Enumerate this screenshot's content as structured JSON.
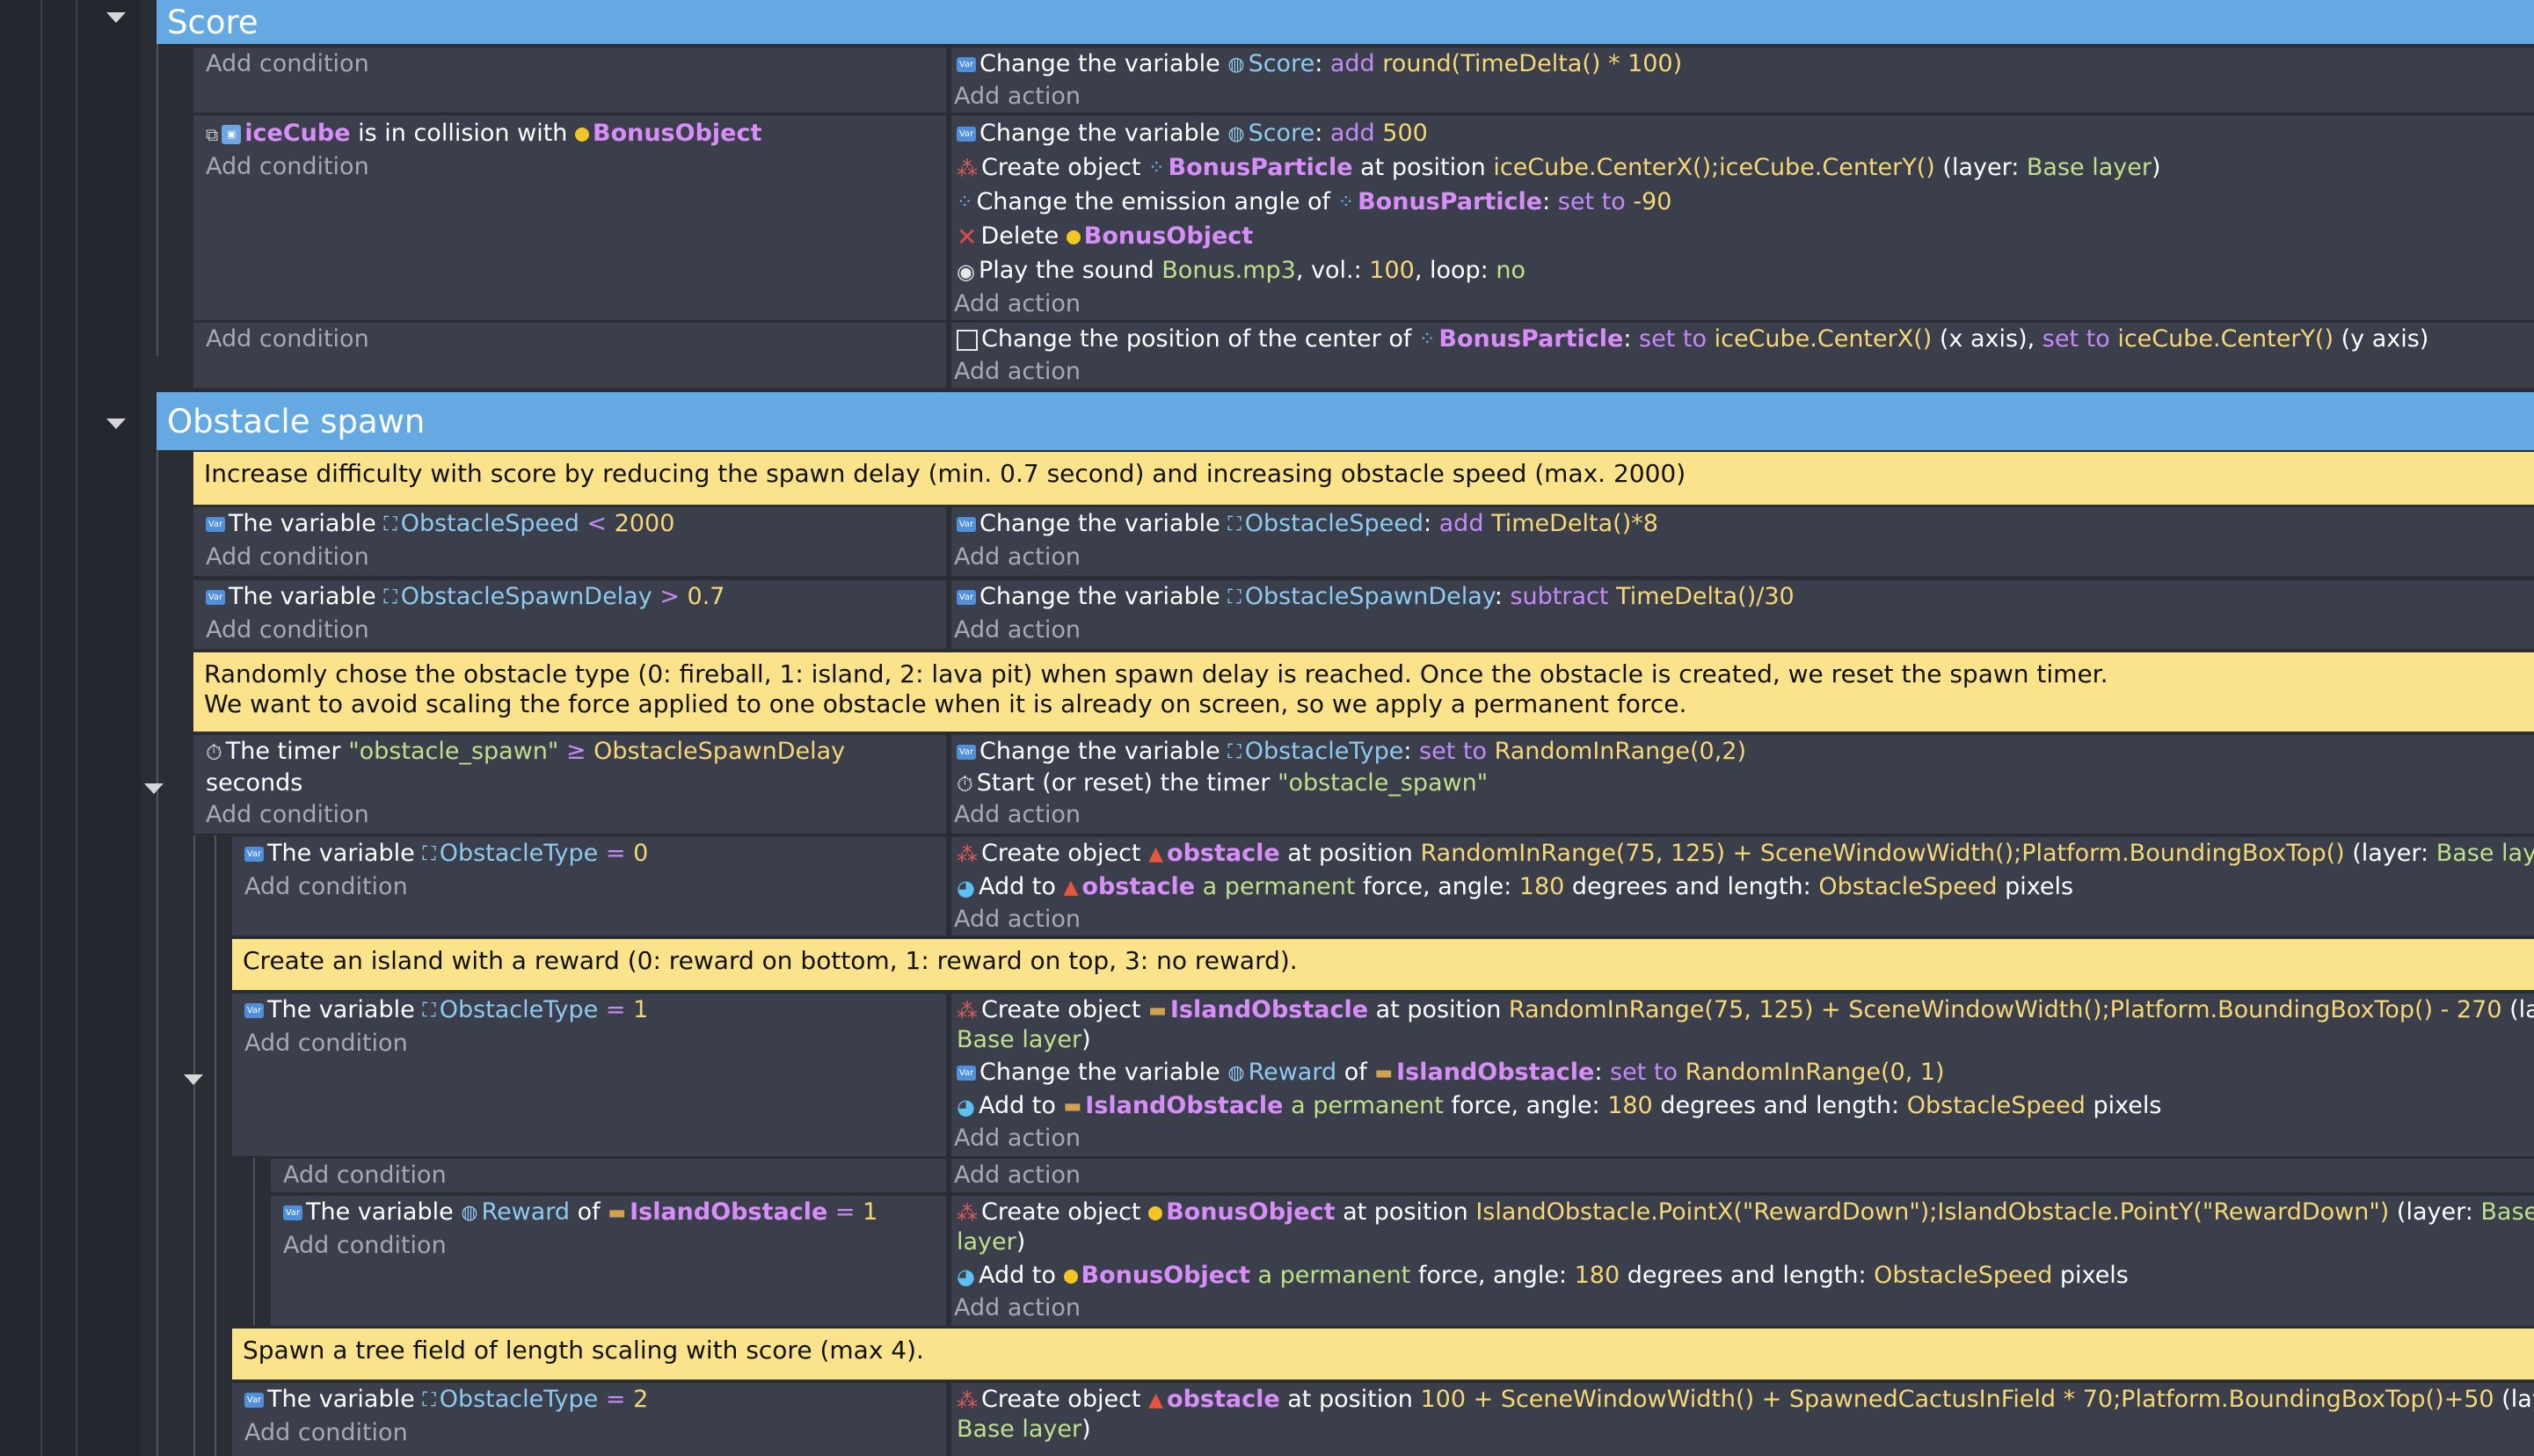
{
  "groups": {
    "score": "Score",
    "obstacle_spawn": "Obstacle spawn"
  },
  "labels": {
    "add_condition": "Add condition",
    "add_action": "Add action"
  },
  "comments": {
    "c1": "Increase difficulty with score by reducing the spawn delay (min. 0.7 second) and increasing obstacle speed (max. 2000)",
    "c2a": "Randomly chose the obstacle type (0: fireball, 1: island, 2: lava pit) when spawn delay is reached. Once the obstacle is created, we reset the spawn timer.",
    "c2b": "We want to avoid scaling the force applied to one obstacle when it is already on screen, so we apply a permanent force.",
    "c3": "Create an island with a reward (0: reward on bottom, 1: reward on top, 3: no reward).",
    "c4": "Spawn a tree field of length scaling with score (max 4)."
  },
  "events": {
    "e1": {
      "a1": [
        "Change the variable ",
        "Score",
        ": ",
        "add",
        " ",
        "round(TimeDelta() * 100)"
      ]
    },
    "e2": {
      "c1": [
        "iceCube",
        " is in collision with ",
        "BonusObject"
      ],
      "a1": [
        "Change the variable ",
        "Score",
        ": ",
        "add",
        " ",
        "500"
      ],
      "a2": [
        "Create object ",
        "BonusParticle",
        " at position ",
        "iceCube.CenterX();iceCube.CenterY()",
        " (layer: ",
        "Base layer",
        ")"
      ],
      "a3": [
        "Change the emission angle of ",
        "BonusParticle",
        ": ",
        "set to",
        " ",
        "-90"
      ],
      "a4": [
        "Delete ",
        "BonusObject"
      ],
      "a5": [
        "Play the sound ",
        "Bonus.mp3",
        ", vol.: ",
        "100",
        ", loop: ",
        "no"
      ]
    },
    "e3": {
      "a1": [
        "Change the position of the center of ",
        "BonusParticle",
        ": ",
        "set to",
        " ",
        "iceCube.CenterX()",
        " (x axis), ",
        "set to",
        " ",
        "iceCube.CenterY()",
        " (y axis)"
      ]
    },
    "e4": {
      "c1": [
        "The variable ",
        "ObstacleSpeed",
        " < ",
        "2000"
      ],
      "a1": [
        "Change the variable ",
        "ObstacleSpeed",
        ": ",
        "add",
        " ",
        "TimeDelta()*8"
      ]
    },
    "e5": {
      "c1": [
        "The variable ",
        "ObstacleSpawnDelay",
        " > ",
        "0.7"
      ],
      "a1": [
        "Change the variable ",
        "ObstacleSpawnDelay",
        ": ",
        "subtract",
        " ",
        "TimeDelta()/30"
      ]
    },
    "e6": {
      "c1": [
        "The timer ",
        "\"obstacle_spawn\"",
        " ≥ ",
        "ObstacleSpawnDelay"
      ],
      "c1b": "seconds",
      "a1": [
        "Change the variable ",
        "ObstacleType",
        ": ",
        "set to",
        " ",
        "RandomInRange(0,2)"
      ],
      "a2": [
        "Start (or reset) the timer ",
        "\"obstacle_spawn\""
      ]
    },
    "e7": {
      "c1": [
        "The variable ",
        "ObstacleType",
        " = ",
        "0"
      ],
      "a1": [
        "Create object ",
        "obstacle",
        " at position ",
        "RandomInRange(75, 125) + SceneWindowWidth();Platform.BoundingBoxTop()",
        " (layer: ",
        "Base layer",
        ")"
      ],
      "a2": [
        "Add to ",
        "obstacle",
        " ",
        "a permanent",
        " force, angle: ",
        "180",
        " degrees and length: ",
        "ObstacleSpeed",
        " pixels"
      ]
    },
    "e8": {
      "c1": [
        "The variable ",
        "ObstacleType",
        " = ",
        "1"
      ],
      "a1": [
        "Create object ",
        "IslandObstacle",
        " at position ",
        "RandomInRange(75, 125) + SceneWindowWidth();Platform.BoundingBoxTop() - 270",
        " (layer:"
      ],
      "a1b": [
        "Base layer",
        ")"
      ],
      "a2": [
        "Change the variable ",
        "Reward",
        " of ",
        "IslandObstacle",
        ": ",
        "set to",
        " ",
        "RandomInRange(0, 1)"
      ],
      "a3": [
        "Add to ",
        "IslandObstacle",
        " ",
        "a permanent",
        " force, angle: ",
        "180",
        " degrees and length: ",
        "ObstacleSpeed",
        " pixels"
      ]
    },
    "e9": {
      "c1": [
        "The variable ",
        "Reward",
        " of ",
        "IslandObstacle",
        " = ",
        "1"
      ],
      "a1": [
        "Create object ",
        "BonusObject",
        " at position ",
        "IslandObstacle.PointX(\"RewardDown\");IslandObstacle.PointY(\"RewardDown\")",
        " (layer: ",
        "Base"
      ],
      "a1b": [
        "layer",
        ")"
      ],
      "a2": [
        "Add to ",
        "BonusObject",
        " ",
        "a permanent",
        " force, angle: ",
        "180",
        " degrees and length: ",
        "ObstacleSpeed",
        " pixels"
      ]
    },
    "e10": {
      "c1": [
        "The variable ",
        "ObstacleType",
        " = ",
        "2"
      ],
      "a1": [
        "Create object ",
        "obstacle",
        " at position ",
        "100 + SceneWindowWidth() + SpawnedCactusInField * 70;Platform.BoundingBoxTop()+50",
        " (layer:"
      ],
      "a1b": [
        "Base layer",
        ")"
      ]
    }
  },
  "icons": {
    "var": "variable-icon",
    "timer": "timer-icon"
  }
}
